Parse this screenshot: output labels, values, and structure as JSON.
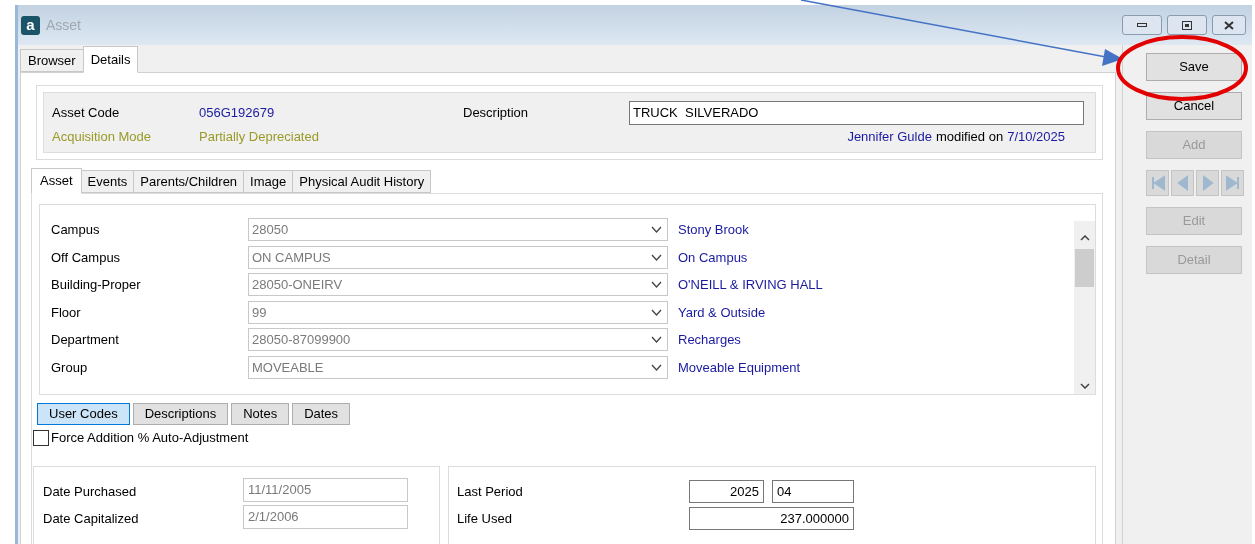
{
  "window": {
    "logo": "a",
    "title": "Asset"
  },
  "tabs": [
    {
      "label": "Browser",
      "selected": false
    },
    {
      "label": "Details",
      "selected": true
    }
  ],
  "header": {
    "asset_code_label": "Asset Code",
    "asset_code": "056G192679",
    "acquisition_mode_label": "Acquisition Mode",
    "acquisition_mode": "Partially Depreciated",
    "description_label": "Description",
    "description": "TRUCK  SILVERADO",
    "modified_by": "Jennifer Gulde",
    "modified_text": "modified on",
    "modified_date": "7/10/2025"
  },
  "sub_tabs": [
    {
      "label": "Asset",
      "selected": true
    },
    {
      "label": "Events",
      "selected": false
    },
    {
      "label": "Parents/Children",
      "selected": false
    },
    {
      "label": "Image",
      "selected": false
    },
    {
      "label": "Physical Audit History",
      "selected": false
    }
  ],
  "fields": [
    {
      "label": "Campus",
      "value": "28050",
      "disabled": true,
      "description": "Stony Brook"
    },
    {
      "label": "Off Campus",
      "value": "ON CAMPUS",
      "disabled": true,
      "description": "On Campus"
    },
    {
      "label": "Building-Proper",
      "value": "28050-ONEIRV",
      "disabled": true,
      "description": "O'NEILL & IRVING HALL"
    },
    {
      "label": "Floor",
      "value": "99",
      "disabled": true,
      "description": "Yard & Outside"
    },
    {
      "label": "Department",
      "value": "28050-87099900",
      "disabled": true,
      "description": "Recharges"
    },
    {
      "label": "Group",
      "value": "MOVEABLE",
      "disabled": true,
      "description": "Moveable Equipment"
    }
  ],
  "section_buttons": [
    {
      "label": "User Codes",
      "selected": true
    },
    {
      "label": "Descriptions",
      "selected": false
    },
    {
      "label": "Notes",
      "selected": false
    },
    {
      "label": "Dates",
      "selected": false
    }
  ],
  "force_addition": {
    "label": "Force Addition % Auto-Adjustment",
    "checked": false
  },
  "dates": [
    {
      "label": "Date Purchased",
      "value": "11/11/2005",
      "disabled": true
    },
    {
      "label": "Date Capitalized",
      "value": "2/1/2006",
      "disabled": true
    }
  ],
  "period": {
    "label": "Last Period",
    "year": "2025",
    "period": "04"
  },
  "life_used": {
    "label": "Life Used",
    "value": "237.000000"
  },
  "actions": [
    {
      "label": "Save",
      "disabled": false
    },
    {
      "label": "Cancel",
      "disabled": false
    },
    {
      "label": "Add",
      "disabled": true
    },
    {
      "label": "Edit",
      "disabled": true
    },
    {
      "label": "Detail",
      "disabled": true
    }
  ]
}
